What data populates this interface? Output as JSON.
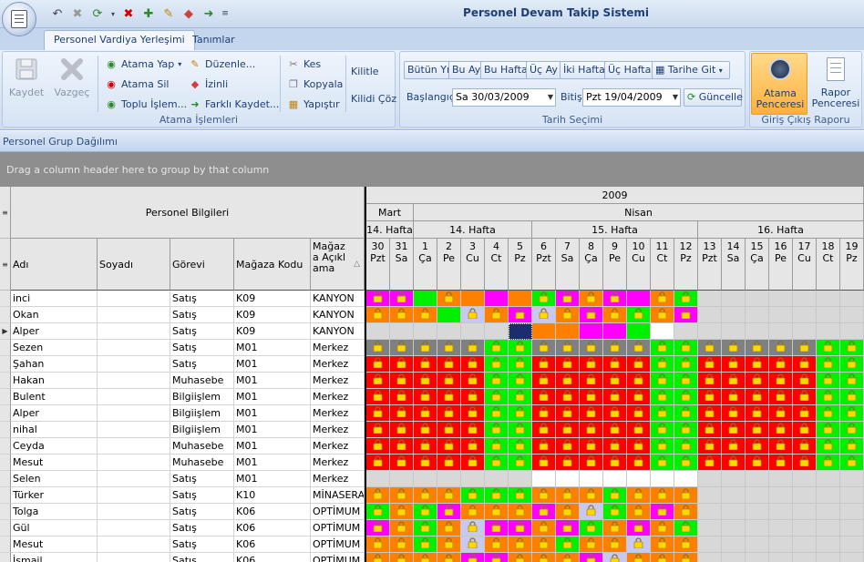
{
  "app": {
    "title": "Personel Devam Takip Sistemi"
  },
  "qat": {
    "icons": [
      "undo-icon",
      "close-x-icon",
      "refresh-add-icon",
      "dropdown-arrow-icon",
      "delete-icon",
      "add-icon",
      "pen-icon",
      "tag-icon",
      "exit-icon",
      "customize-icon"
    ]
  },
  "tabs": [
    {
      "label": "Personel Vardiya Yerleşimi"
    },
    {
      "label": "Tanımlar"
    }
  ],
  "ribbon": {
    "kaydet": "Kaydet",
    "vazgec": "Vazgeç",
    "atama_yap": "Atama Yap",
    "atama_sil": "Atama Sil",
    "toplu_islem": "Toplu İşlem...",
    "duzenle": "Düzenle...",
    "izinli": "İzinli",
    "farkli_kaydet": "Farklı Kaydet...",
    "kes": "Kes",
    "kopyala": "Kopyala",
    "yapistir": "Yapıştır",
    "kilitle": "Kilitle",
    "kilidi_coz": "Kilidi Çöz",
    "group_atama": "Atama İşlemleri",
    "range_buttons": [
      "Bütün Yıl",
      "Bu Ay",
      "Bu Hafta",
      "Üç Ay",
      "İki Hafta",
      "Üç Hafta"
    ],
    "tarihe_git": "Tarihe Git",
    "baslangic_label": "Başlangıç",
    "baslangic_value": "Sa 30/03/2009",
    "bitis_label": "Bitiş",
    "bitis_value": "Pzt 19/04/2009",
    "guncelle": "Güncelle",
    "group_tarih": "Tarih Seçimi",
    "atama_penceresi": "Atama\nPenceresi",
    "rapor_penceresi": "Rapor\nPenceresi",
    "group_rapor": "Giriş Çıkış Raporu"
  },
  "panel": {
    "title": "Personel Grup Dağılımı",
    "group_hint": "Drag a column header here to group by that column"
  },
  "grid": {
    "band_personel": "Personel Bilgileri",
    "year": "2009",
    "months": [
      "Mart",
      "Nisan"
    ],
    "weeks": [
      "14. Hafta",
      "14. Hafta",
      "15. Hafta",
      "16. Hafta"
    ],
    "columns": [
      "Adı",
      "Soyadı",
      "Görevi",
      "Mağaza Kodu",
      "Mağaza Açıklama"
    ],
    "sort_glyph": "△",
    "days": [
      [
        "30",
        "Pzt"
      ],
      [
        "31",
        "Sa"
      ],
      [
        "1",
        "Ça"
      ],
      [
        "2",
        "Pe"
      ],
      [
        "3",
        "Cu"
      ],
      [
        "4",
        "Ct"
      ],
      [
        "5",
        "Pz"
      ],
      [
        "6",
        "Pzt"
      ],
      [
        "7",
        "Sa"
      ],
      [
        "8",
        "Ça"
      ],
      [
        "9",
        "Pe"
      ],
      [
        "10",
        "Cu"
      ],
      [
        "11",
        "Ct"
      ],
      [
        "12",
        "Pz"
      ],
      [
        "13",
        "Pzt"
      ],
      [
        "14",
        "Sa"
      ],
      [
        "15",
        "Ça"
      ],
      [
        "16",
        "Pe"
      ],
      [
        "17",
        "Cu"
      ],
      [
        "18",
        "Ct"
      ],
      [
        "19",
        "Pz"
      ]
    ],
    "current_row_marker": "▶",
    "rows": [
      {
        "adi": "inci",
        "soyadi": "",
        "gorevi": "Satış",
        "kod": "K09",
        "aciklama": "KANYON",
        "days": "MmGOoMoGMOMmOg.......",
        "locks": "110100011110110000000"
      },
      {
        "adi": "Okan",
        "soyadi": "",
        "gorevi": "Satış",
        "kod": "K09",
        "aciklama": "KANYON",
        "days": "OoOGLOMLOMOgOM.......",
        "locks": "111011111111110000000"
      },
      {
        "adi": "Alper",
        "soyadi": "",
        "gorevi": "Satış",
        "kod": "K09",
        "aciklama": "KANYON",
        "days": "......_NOMMGW.......",
        "locks": "000000000000000000000"
      },
      {
        "adi": "Sezen",
        "soyadi": "",
        "gorevi": "Satış",
        "kod": "M01",
        "aciklama": "Merkez",
        "days": "YYYYYGGYYYYYGGYYYYYGG",
        "locks": "111111111111111111111"
      },
      {
        "adi": "Şahan",
        "soyadi": "",
        "gorevi": "Satış",
        "kod": "M01",
        "aciklama": "Merkez",
        "days": "RRRRRGGRRRRRGGRRRRRGG",
        "locks": "111111111111111111111"
      },
      {
        "adi": "Hakan",
        "soyadi": "",
        "gorevi": "Muhasebe",
        "kod": "M01",
        "aciklama": "Merkez",
        "days": "RRRRRGGRRRRRGGRRRRRGG",
        "locks": "111111111111111111111"
      },
      {
        "adi": "Bulent",
        "soyadi": "",
        "gorevi": "Bilgiişlem",
        "kod": "M01",
        "aciklama": "Merkez",
        "days": "RRRRRGGRRRRRGGRRRRRGG",
        "locks": "111111111111111111111"
      },
      {
        "adi": "Alper",
        "soyadi": "",
        "gorevi": "Bilgiişlem",
        "kod": "M01",
        "aciklama": "Merkez",
        "days": "RRRRRGGRRRRRGGRRRRRGG",
        "locks": "111111111111111111111"
      },
      {
        "adi": "nihal",
        "soyadi": "",
        "gorevi": "Bilgiişlem",
        "kod": "M01",
        "aciklama": "Merkez",
        "days": "RRRRRGGRRRRRGGRRRRRGG",
        "locks": "111111111111111111111"
      },
      {
        "adi": "Ceyda",
        "soyadi": "",
        "gorevi": "Muhasebe",
        "kod": "M01",
        "aciklama": "Merkez",
        "days": "RRRRRGGRRRRRGGRRRRRGG",
        "locks": "111111111111111111111"
      },
      {
        "adi": "Mesut",
        "soyadi": "",
        "gorevi": "Muhasebe",
        "kod": "M01",
        "aciklama": "Merkez",
        "days": "RRRRRGGRRRRRGGRRRRRGG",
        "locks": "111111111111111111111"
      },
      {
        "adi": "Selen",
        "soyadi": "",
        "gorevi": "Satış",
        "kod": "M01",
        "aciklama": "Merkez",
        "days": ".......WWWWWWW.......",
        "locks": "000000000000000000000"
      },
      {
        "adi": "Türker",
        "soyadi": "",
        "gorevi": "Satış",
        "kod": "K10",
        "aciklama": "MİNASERA",
        "days": "OOOOGGGOOOGOOO.......",
        "locks": "111111111111110000000"
      },
      {
        "adi": "Tolga",
        "soyadi": "",
        "gorevi": "Satış",
        "kod": "K06",
        "aciklama": "OPTİMUM",
        "days": "GOGMOOOMOLGOMO.......",
        "locks": "111111111111110000000"
      },
      {
        "adi": "Gül",
        "soyadi": "",
        "gorevi": "Satış",
        "kod": "K06",
        "aciklama": "OPTİMUM",
        "days": "MOGOLMMOMGOMOG.......",
        "locks": "111111111111110000000"
      },
      {
        "adi": "Mesut",
        "soyadi": "",
        "gorevi": "Satış",
        "kod": "K06",
        "aciklama": "OPTİMUM",
        "days": "OOGOLOOOGOOLOO.......",
        "locks": "111111111111110000000"
      },
      {
        "adi": "İsmail",
        "soyadi": "",
        "gorevi": "Satış",
        "kod": "K06",
        "aciklama": "OPTİMUM",
        "days": "OOOOMMOOOMLOOO.......",
        "locks": "111111111111110000000"
      }
    ]
  },
  "colors": {
    "R": "#ff0000",
    "G": "#00f000",
    "Y": "#808080",
    "O": "#ff8000",
    "M": "#ff00ff",
    "L": "#c8c8f0",
    "g": "#00f000",
    "m": "#ff00ff",
    "o": "#ff8000",
    "W": "#ffffff",
    ".": "#d8d8d8",
    "_": "#1c2d6e",
    "N": "#ff8000",
    "accent_title": "#1e3f74",
    "lock": "#ffd800"
  }
}
